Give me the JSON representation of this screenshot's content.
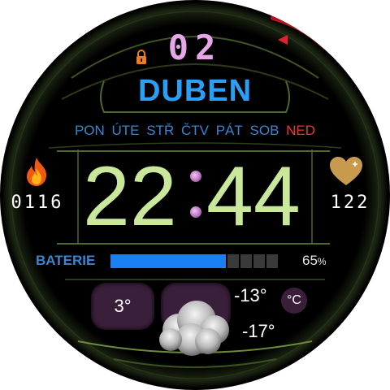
{
  "date": {
    "day": "02",
    "month": "DUBEN"
  },
  "weekdays": [
    "PON",
    "ÚTE",
    "STŘ",
    "ČTV",
    "PÁT",
    "SOB",
    "NED"
  ],
  "active_weekday": "NED",
  "time": {
    "hours": "22",
    "minutes": "44"
  },
  "steps": "0116",
  "heart_rate": "122",
  "battery": {
    "label": "BATERIE",
    "percent_value": "65",
    "percent_sign": "%",
    "level": 0.65
  },
  "weather": {
    "current_temp": "3°",
    "max_temp": "-13°",
    "min_temp": "-17°",
    "unit": "°C",
    "condition_icon": "cloud-icon"
  },
  "icons": [
    "lock-icon",
    "alarm-indicator-icon",
    "flame-icon",
    "heart-icon",
    "cloud-icon"
  ],
  "colors": {
    "background": "#000000",
    "day": "#e8a6ea",
    "month": "#2a9ff5",
    "weekday": "#3a84d0",
    "weekday_active": "#f03434",
    "time": "#c9e89b",
    "battery_fill": "#1a7ff2",
    "accent_frame": "#6e8a3d"
  }
}
